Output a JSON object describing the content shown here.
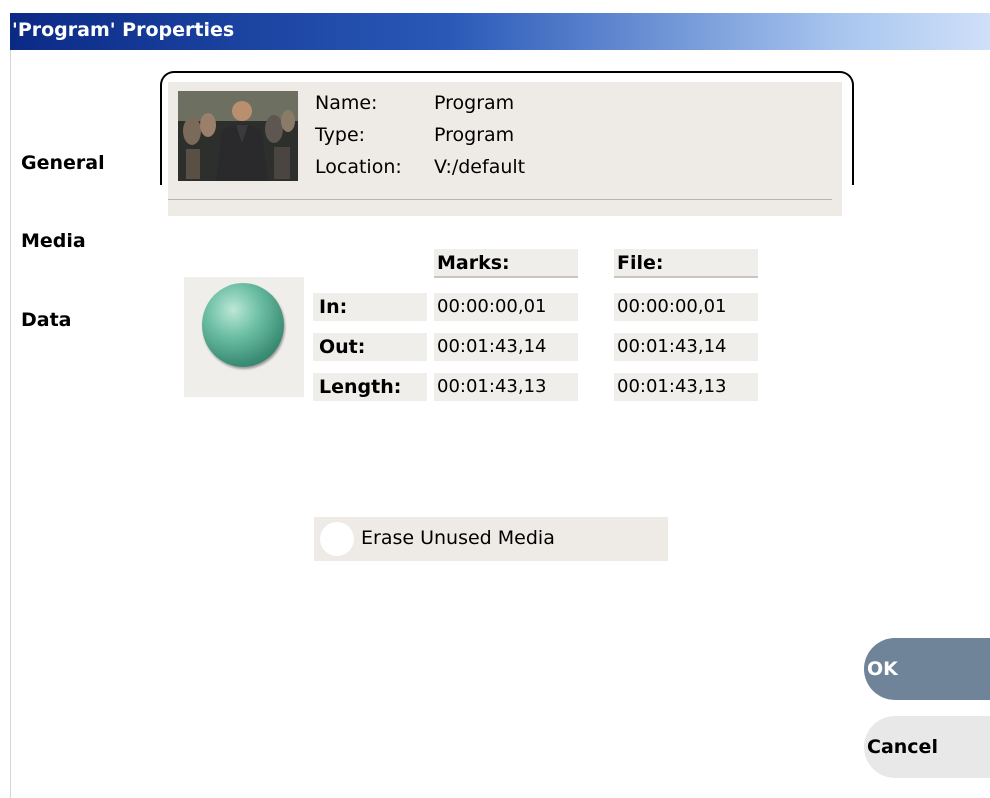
{
  "window": {
    "title": "'Program' Properties"
  },
  "tabs": [
    {
      "label": "General"
    },
    {
      "label": "Media"
    },
    {
      "label": "Data"
    }
  ],
  "info": {
    "name_label": "Name:",
    "name_value": "Program",
    "type_label": "Type:",
    "type_value": "Program",
    "location_label": "Location:",
    "location_value": "V:/default"
  },
  "media": {
    "headers": {
      "marks": "Marks:",
      "file": "File:"
    },
    "rows": [
      {
        "label": "In:",
        "marks": "00:00:00,01",
        "file": "00:00:00,01"
      },
      {
        "label": "Out:",
        "marks": "00:01:43,14",
        "file": "00:01:43,14"
      },
      {
        "label": "Length:",
        "marks": "00:01:43,13",
        "file": "00:01:43,13"
      }
    ]
  },
  "erase_unused_media": {
    "label": "Erase Unused Media",
    "checked": false
  },
  "buttons": {
    "ok": "OK",
    "cancel": "Cancel"
  },
  "colors": {
    "title_start": "#0b2a86",
    "title_end": "#cfe0f8",
    "ok_button": "#6f8499",
    "sphere": "#3d8e76"
  }
}
